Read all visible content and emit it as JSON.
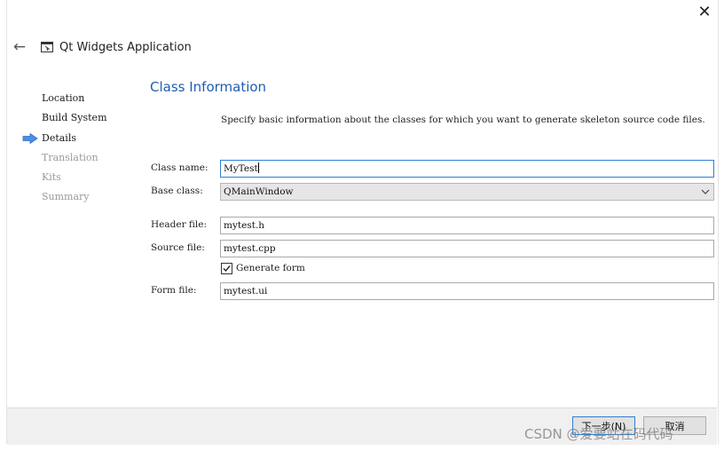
{
  "window": {
    "title": "Qt Widgets Application",
    "close_glyph": "✕",
    "back_glyph": "←"
  },
  "sidebar": {
    "items": [
      {
        "label": "Location",
        "state": "done"
      },
      {
        "label": "Build System",
        "state": "done"
      },
      {
        "label": "Details",
        "state": "current"
      },
      {
        "label": "Translation",
        "state": "pending"
      },
      {
        "label": "Kits",
        "state": "pending"
      },
      {
        "label": "Summary",
        "state": "pending"
      }
    ],
    "current_marker_color": "#4a8ee8"
  },
  "main": {
    "title": "Class Information",
    "description": "Specify basic information about the classes for which you want to generate skeleton source code files.",
    "fields": {
      "class_name": {
        "label": "Class name:",
        "value": "MyTest"
      },
      "base_class": {
        "label": "Base class:",
        "value": "QMainWindow"
      },
      "header_file": {
        "label": "Header file:",
        "value": "mytest.h"
      },
      "source_file": {
        "label": "Source file:",
        "value": "mytest.cpp"
      },
      "generate_form": {
        "label": "Generate form",
        "checked": true
      },
      "form_file": {
        "label": "Form file:",
        "value": "mytest.ui"
      }
    }
  },
  "footer": {
    "next_label": "下一步(N)",
    "cancel_label": "取消"
  },
  "watermark": "CSDN @爱要站在码代码",
  "colors": {
    "accent": "#1f5db3",
    "focus_border": "#2f7fd6"
  }
}
